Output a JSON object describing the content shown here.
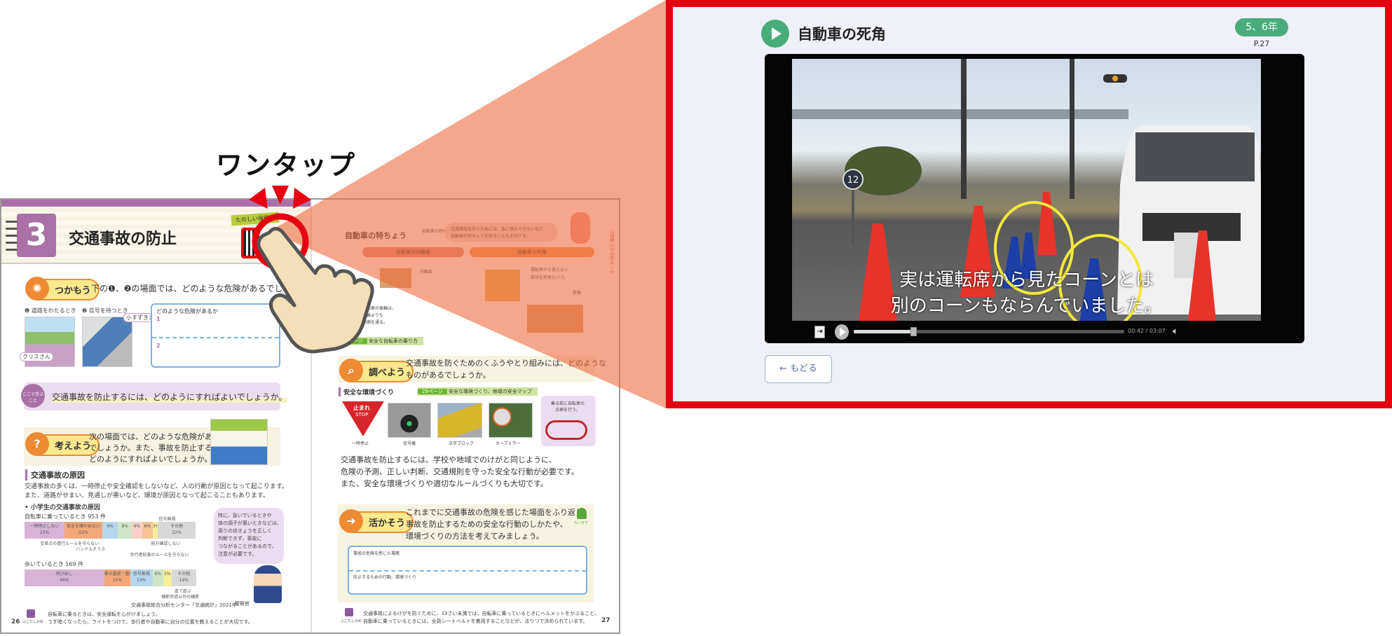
{
  "callout": {
    "label": "ワンタップ"
  },
  "colors": {
    "highlight_red": "#e50012",
    "accent_green": "#48ad7a",
    "beam_orange": "#f08a5c",
    "chapter_purple": "#a971a8"
  },
  "textbook": {
    "chapter_number": "3",
    "chapter_title": "交通事故の防止",
    "header_tag": "たのしい保健を",
    "left_page": {
      "page_number": "26",
      "tsukamou": {
        "label": "つかもう",
        "question": "下の❶、❷の場面では、どのような危険があるでしょうか。",
        "scene1": "❶ 道路をわたるとき",
        "scene2": "❷ 信号を待つとき",
        "label1": "クリスさん",
        "label2": "小すずきさん",
        "answer_prompt": "どのような危険があるか",
        "answer_1": "1",
        "answer_2": "2"
      },
      "koko": {
        "badge": "ここで学ぶこと",
        "text": "交通事故を防止するには、どのようにすればよいでしょうか。"
      },
      "kangaeyou": {
        "label": "考えよう",
        "text": [
          "次の場面では、どのような危険がある",
          "でしょうか。また、事故を防止するには、",
          "どのようにすればよいでしょうか。"
        ]
      },
      "section_title": "交通事故の原因",
      "body": [
        "交通事故の多くは、一時停止や安全確認をしないなど、人の行動が原因となって起こります。",
        "また、道路がせまい、見通しが悪いなど、環境が原因となって起こることもあります。"
      ],
      "chart_title": "• 小学生の交通事故の原因",
      "bicycle": {
        "label": "自転車に乗っているとき 953 件",
        "segments": [
          {
            "name": "一時停止しない",
            "value": 23
          },
          {
            "name": "安全を確かめない",
            "value": 22
          },
          {
            "name": "交差点の進行ルールを守らない",
            "value": 9
          },
          {
            "name": "ハンドルそうさ",
            "value": 8
          },
          {
            "name": "歩行者妨害のルールを守らない",
            "value": 6
          },
          {
            "name": "前方確認しない",
            "value": 6
          },
          {
            "name": "信号無視",
            "value": 3
          },
          {
            "name": "その他",
            "value": 22
          }
        ]
      },
      "walking": {
        "label": "歩いているとき 169 件",
        "segments": [
          {
            "name": "飛び出し",
            "value": 46
          },
          {
            "name": "車の直前・直後の横断",
            "value": 15
          },
          {
            "name": "信号無視",
            "value": 13
          },
          {
            "name": "横断歩道以外の横断",
            "value": 6
          },
          {
            "name": "道で遊ぶ",
            "value": 5
          },
          {
            "name": "その他",
            "value": 14
          }
        ]
      },
      "source": "交通事故総合分析センター「交通統計」2021年",
      "speech": [
        "特に、急いでいるときや",
        "体の調子が悪いときなどは、",
        "周りの状きょうを正しく",
        "判断できず、事故に",
        "つながることがあるので、",
        "注意が必要です。"
      ],
      "officer_label": "警察官",
      "footer_badge": "ふこたしかめ",
      "footer": [
        "自転車に乗るときは、安全運転を心がけましょう。",
        "うす暗くなったら、ライトをつけて、歩行者や自動車に自分の位置を教えることが大切です。"
      ]
    },
    "right_page": {
      "page_number": "27",
      "feature_title": "自動車の特ちょう",
      "feature_tag": "自動車の特ちょう",
      "rabbit_speech": [
        "交通事故を防ぐためには、急に停止できないなど、",
        "自動車の特ちょうを知ることも大切です。"
      ],
      "inner_wheel": "自動車の内輪差",
      "blind_spot": "自動車の死角",
      "inner_note": [
        "自動車の後輪は、",
        "前輪よりも",
        "内側を通る。"
      ],
      "blind_note": [
        "運転席から見えない",
        "部分を死角という。"
      ],
      "label_naillinsa": "内輪差",
      "label_shikaku": "死角",
      "link1": {
        "page": "29ページ",
        "text": "安全な自転車の乗り方"
      },
      "side_tab": "5保健 けがの防止 ー3",
      "shirabeyou": {
        "label": "調べよう",
        "text": [
          "交通事故を防ぐためのくふうやとり組みには、どのような",
          "ものがあるでしょうか。"
        ]
      },
      "env_title": "安全な環境づくり",
      "link2": {
        "page": "29ページ",
        "text": "安全な環境づくり、地域の安全マップ"
      },
      "photos": [
        "一時停止",
        "信号機",
        "点字ブロック",
        "カーブミラー"
      ],
      "stop_sign": {
        "top": "止まれ",
        "bottom": "STOP"
      },
      "bike_note": [
        "乗る前に自転車の",
        "点検を行う。"
      ],
      "summary": [
        "交通事故を防止するには、学校や地域でのけがと同じように、",
        "危険の予測、正しい判断、交通規則を守った安全な行動が必要です。",
        "また、安全な環境づくりや適切なルールづくりも大切です。"
      ],
      "ikasou": {
        "label": "活かそう",
        "text": [
          "これまでに交通事故の危険を感じた場面をふり返り、",
          "事故を防止するための安全な行動のしかたや、",
          "環境づくりの方法を考えてみましょう。"
        ],
        "badge": "ちいきで"
      },
      "write1": "事故の危険を感じた場面",
      "write2": "防止するための行動、環境づくり",
      "footer_badge": "ふこたしかめ",
      "footer": [
        "交通事故によるけがを防ぐために、13さい未満では、自転車に乗っているときにヘルメットをかぶること、",
        "自動車に乗っているときには、全員シートベルトを着用することなどが、法りつで決められています。"
      ]
    }
  },
  "video_panel": {
    "title": "自動車の死角",
    "grade": "5、6年",
    "page_ref": "P.27",
    "subtitle_line1": "実は運転席から見たコーンとは",
    "subtitle_line2": "別のコーンもならんでいました。",
    "sign_number": "12",
    "time_current": "00:42",
    "time_total": "03:07",
    "progress": 0.22,
    "back_label": "← もどる"
  }
}
